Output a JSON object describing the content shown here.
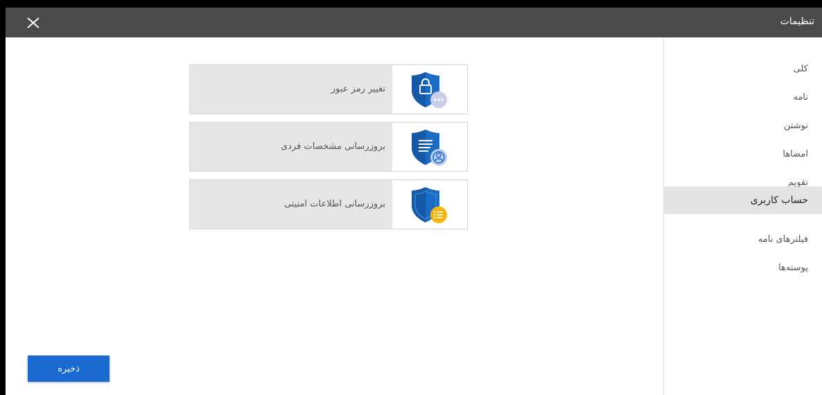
{
  "window": {
    "title": "تنظیمات"
  },
  "sidebar": {
    "items": [
      {
        "label": "کلی",
        "active": false
      },
      {
        "label": "نامه",
        "active": false
      },
      {
        "label": "نوشتن",
        "active": false
      },
      {
        "label": "امضاها",
        "active": false
      },
      {
        "label": "تقویم",
        "active": false
      },
      {
        "label": "حساب کاربری",
        "active": true
      },
      {
        "label": "فیلترهای نامه",
        "active": false
      },
      {
        "label": "پوسته‌ها",
        "active": false
      }
    ]
  },
  "cards": [
    {
      "label": "تغییر رمز عبور",
      "icon": "shield-lock-icon",
      "badge": "dots-badge-icon",
      "badge_color": "#c9cde6"
    },
    {
      "label": "بروزرسانی مشخصات فردی",
      "icon": "shield-document-icon",
      "badge": "user-badge-icon",
      "badge_color": "#b8cbe8"
    },
    {
      "label": "بروزرسانی اطلاعات امنیتی",
      "icon": "shield-outline-icon",
      "badge": "list-badge-icon",
      "badge_color": "#f5b50a"
    }
  ],
  "footer": {
    "save_label": "ذخیره"
  },
  "colors": {
    "titlebar": "#4a4a4a",
    "primary": "#1b6ad2",
    "shield": "#1a6bc4",
    "active_item": "#e3e3e3"
  }
}
